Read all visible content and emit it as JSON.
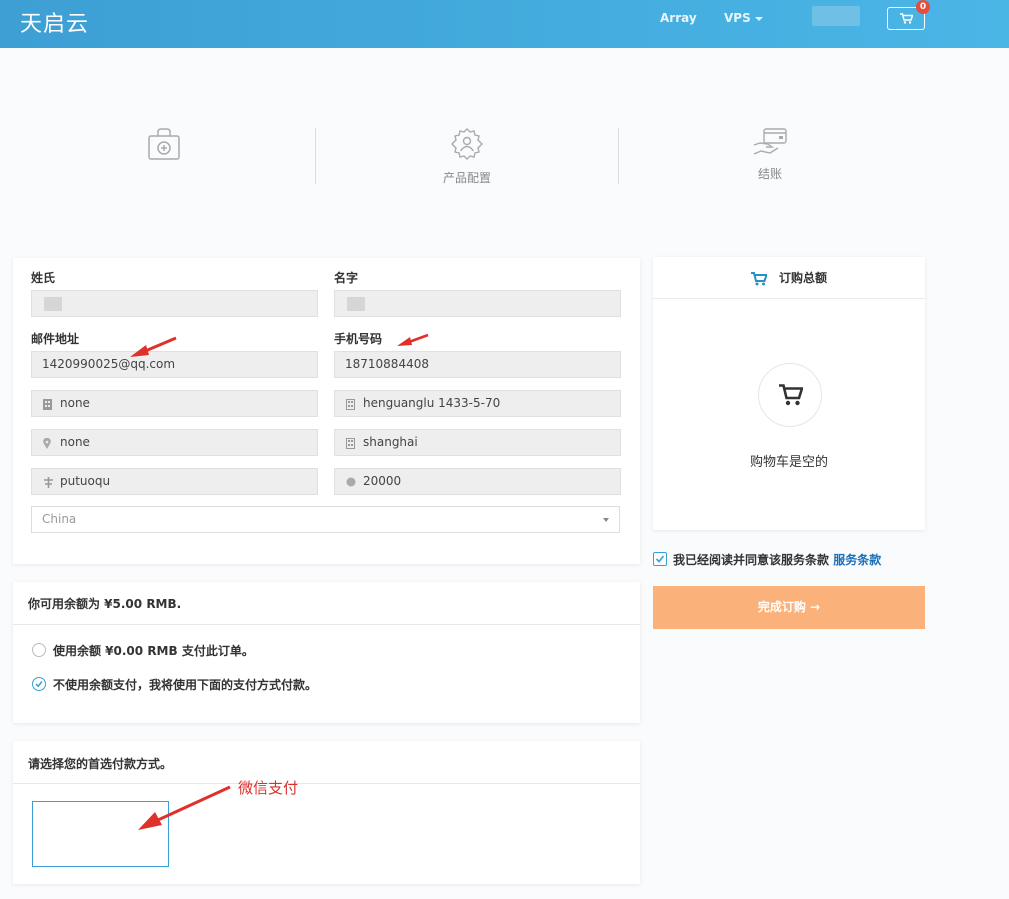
{
  "header": {
    "logo": "天启云",
    "nav_array": "Array",
    "nav_vps": "VPS",
    "cart_count": "0"
  },
  "steps": [
    {
      "label": "",
      "icon": "bag-add-icon"
    },
    {
      "label": "产品配置",
      "icon": "gear-user-icon"
    },
    {
      "label": "结账",
      "icon": "card-hand-icon"
    }
  ],
  "form": {
    "last_name_label": "姓氏",
    "first_name_label": "名字",
    "email_label": "邮件地址",
    "email_value": "1420990025@qq.com",
    "phone_label": "手机号码",
    "phone_value": "18710884408",
    "company_value": "none",
    "address1_value": "henguanglu 1433-5-70",
    "address2_value": "none",
    "city_value": "shanghai",
    "state_value": "putuoqu",
    "postcode_value": "20000",
    "country_value": "China"
  },
  "balance": {
    "title": "你可用余额为 ¥5.00 RMB.",
    "option_use": "使用余额 ¥0.00 RMB 支付此订单。",
    "option_no": "不使用余额支付，我将使用下面的支付方式付款。"
  },
  "payment": {
    "title": "请选择您的首选付款方式。"
  },
  "summary": {
    "title": "订购总额",
    "empty": "购物车是空的"
  },
  "tos": {
    "text": "我已经阅读并同意该服务条款",
    "link": "服务条款"
  },
  "complete_button": "完成订购 →",
  "annotation": {
    "wechat": "微信支付"
  },
  "colors": {
    "header": "#4ab6e6",
    "accent": "#3a9fd4",
    "button": "#fbb27a",
    "annotation": "#d9302c"
  }
}
